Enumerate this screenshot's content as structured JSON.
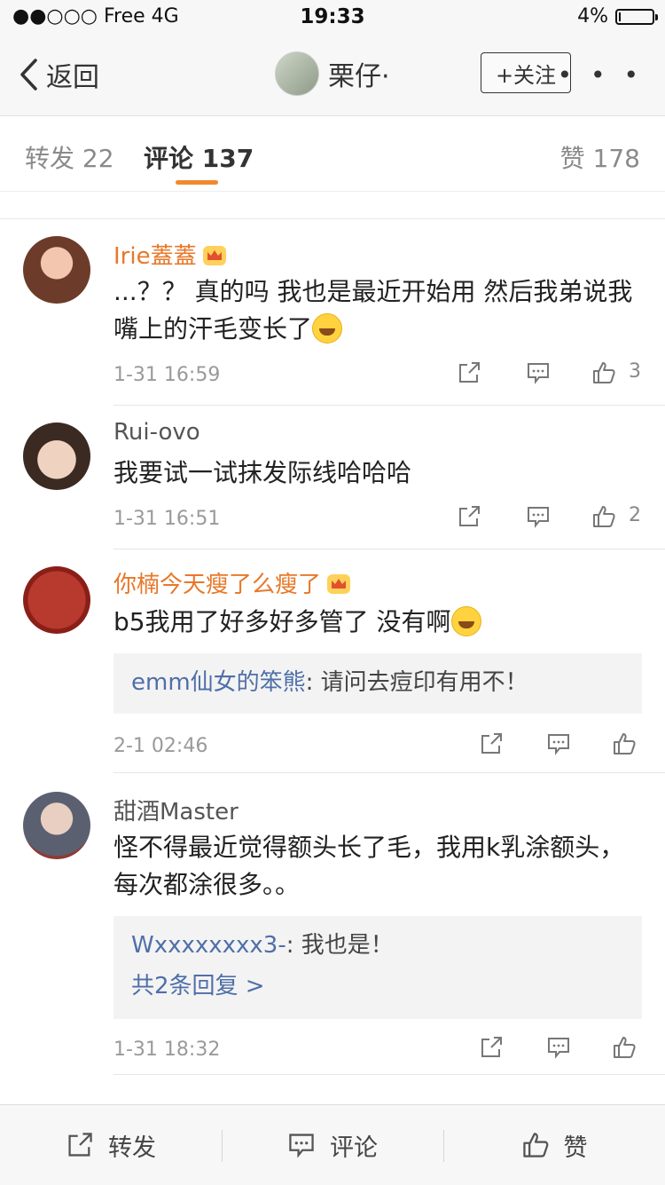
{
  "status_bar": {
    "signal": "●●○○○ Free   4G",
    "time": "19:33",
    "battery": "4%",
    "battery_level": 0.04
  },
  "nav": {
    "back_label": "返回",
    "user_name": "栗仔·",
    "follow_label": "+关注",
    "more_label": "• • •"
  },
  "tabs": {
    "repost": "转发 22",
    "comment": "评论 137",
    "like": "赞 178"
  },
  "comments": [
    {
      "user": "Irie蓋蓋",
      "text": "...？？ 真的吗 我也是最近开始用 然后我弟说我嘴上的汗毛变长了",
      "time": "1-31 16:59",
      "likes": "3"
    },
    {
      "user": "Rui-ovo",
      "text": "我要试一试抹发际线哈哈哈",
      "time": "1-31 16:51",
      "likes": "2"
    },
    {
      "user": "你楠今天瘦了么瘦了",
      "text": "b5我用了好多好多管了 没有啊",
      "reply_user": "emm仙女的笨熊",
      "reply_text": ": 请问去痘印有用不！",
      "time": "2-1 02:46",
      "likes": ""
    },
    {
      "user": "甜酒Master",
      "text": "怪不得最近觉得额头长了毛，我用k乳涂额头，每次都涂很多。。",
      "reply_user": "Wxxxxxxxx3-",
      "reply_text": ": 我也是！",
      "reply_more": "共2条回复 >",
      "time": "1-31 18:32",
      "likes": ""
    }
  ],
  "bottom_bar": {
    "repost": "转发",
    "comment": "评论",
    "like": "赞"
  },
  "colors": {
    "accent": "#f08a2e",
    "vip_name": "#e8782a",
    "link_blue": "#4f6fa8"
  },
  "icons": [
    "back-chevron-icon",
    "share-icon",
    "comment-icon",
    "thumbs-up-icon",
    "crown-icon",
    "emoji-icon"
  ]
}
